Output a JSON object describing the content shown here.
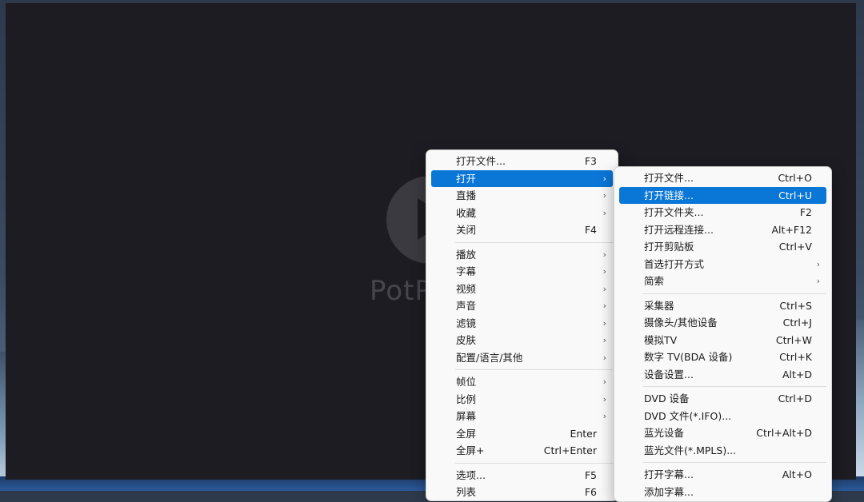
{
  "player": {
    "logo_text": "PotPlayer"
  },
  "main_menu": {
    "groups": [
      [
        {
          "label": "打开文件...",
          "shortcut": "F3",
          "submenu": false
        },
        {
          "label": "打开",
          "shortcut": "",
          "submenu": true,
          "highlighted": true
        },
        {
          "label": "直播",
          "shortcut": "",
          "submenu": true
        },
        {
          "label": "收藏",
          "shortcut": "",
          "submenu": true
        },
        {
          "label": "关闭",
          "shortcut": "F4",
          "submenu": false
        }
      ],
      [
        {
          "label": "播放",
          "shortcut": "",
          "submenu": true
        },
        {
          "label": "字幕",
          "shortcut": "",
          "submenu": true
        },
        {
          "label": "视频",
          "shortcut": "",
          "submenu": true
        },
        {
          "label": "声音",
          "shortcut": "",
          "submenu": true
        },
        {
          "label": "滤镜",
          "shortcut": "",
          "submenu": true
        },
        {
          "label": "皮肤",
          "shortcut": "",
          "submenu": true
        },
        {
          "label": "配置/语言/其他",
          "shortcut": "",
          "submenu": true
        }
      ],
      [
        {
          "label": "帧位",
          "shortcut": "",
          "submenu": true
        },
        {
          "label": "比例",
          "shortcut": "",
          "submenu": true
        },
        {
          "label": "屏幕",
          "shortcut": "",
          "submenu": true
        },
        {
          "label": "全屏",
          "shortcut": "Enter",
          "submenu": false
        },
        {
          "label": "全屏+",
          "shortcut": "Ctrl+Enter",
          "submenu": false
        }
      ],
      [
        {
          "label": "选项...",
          "shortcut": "F5",
          "submenu": false
        },
        {
          "label": "列表",
          "shortcut": "F6",
          "submenu": false
        }
      ]
    ]
  },
  "open_submenu": {
    "groups": [
      [
        {
          "label": "打开文件...",
          "shortcut": "Ctrl+O",
          "submenu": false
        },
        {
          "label": "打开链接...",
          "shortcut": "Ctrl+U",
          "submenu": false,
          "highlighted": true
        },
        {
          "label": "打开文件夹...",
          "shortcut": "F2",
          "submenu": false
        },
        {
          "label": "打开远程连接...",
          "shortcut": "Alt+F12",
          "submenu": false
        },
        {
          "label": "打开剪贴板",
          "shortcut": "Ctrl+V",
          "submenu": false
        },
        {
          "label": "首选打开方式",
          "shortcut": "",
          "submenu": true
        },
        {
          "label": "简索",
          "shortcut": "",
          "submenu": true
        }
      ],
      [
        {
          "label": "采集器",
          "shortcut": "Ctrl+S",
          "submenu": false
        },
        {
          "label": "摄像头/其他设备",
          "shortcut": "Ctrl+J",
          "submenu": false
        },
        {
          "label": "模拟TV",
          "shortcut": "Ctrl+W",
          "submenu": false
        },
        {
          "label": "数字 TV(BDA 设备)",
          "shortcut": "Ctrl+K",
          "submenu": false
        },
        {
          "label": "设备设置...",
          "shortcut": "Alt+D",
          "submenu": false
        }
      ],
      [
        {
          "label": "DVD 设备",
          "shortcut": "Ctrl+D",
          "submenu": false
        },
        {
          "label": "DVD 文件(*.IFO)...",
          "shortcut": "",
          "submenu": false
        },
        {
          "label": "蓝光设备",
          "shortcut": "Ctrl+Alt+D",
          "submenu": false
        },
        {
          "label": "蓝光文件(*.MPLS)...",
          "shortcut": "",
          "submenu": false
        }
      ],
      [
        {
          "label": "打开字幕...",
          "shortcut": "Alt+O",
          "submenu": false
        },
        {
          "label": "添加字幕...",
          "shortcut": "",
          "submenu": false
        }
      ]
    ]
  },
  "icons": {
    "submenu_arrow": "›"
  }
}
